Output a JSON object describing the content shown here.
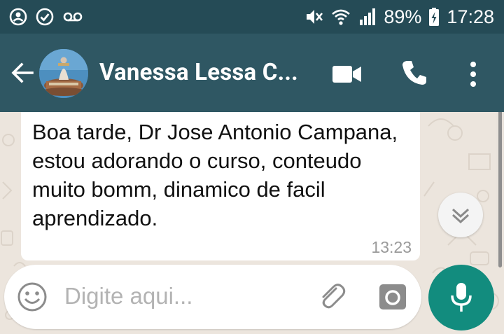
{
  "status_bar": {
    "battery_percent": "89%",
    "time": "17:28",
    "icons": [
      "whatsapp-notification-icon",
      "check-circle-icon",
      "voicemail-icon",
      "mute-icon",
      "wifi-icon",
      "signal-icon",
      "battery-charging-icon"
    ]
  },
  "header": {
    "contact_name": "Vanessa Lessa C...",
    "icons": [
      "back-arrow-icon",
      "contact-avatar",
      "video-call-icon",
      "phone-call-icon",
      "more-options-icon"
    ]
  },
  "messages": [
    {
      "text": "Boa tarde, Dr Jose Antonio Campana, estou adorando o curso, conteudo muito bomm, dinamico de facil aprendizado.",
      "time": "13:23",
      "direction": "incoming"
    }
  ],
  "composer": {
    "placeholder": "Digite aqui...",
    "icons": [
      "emoji-icon",
      "attach-icon",
      "camera-icon",
      "mic-icon"
    ]
  },
  "colors": {
    "status_bar": "#254b56",
    "app_bar": "#2f5763",
    "accent": "#128c7e",
    "chat_background": "#ece5dd"
  }
}
